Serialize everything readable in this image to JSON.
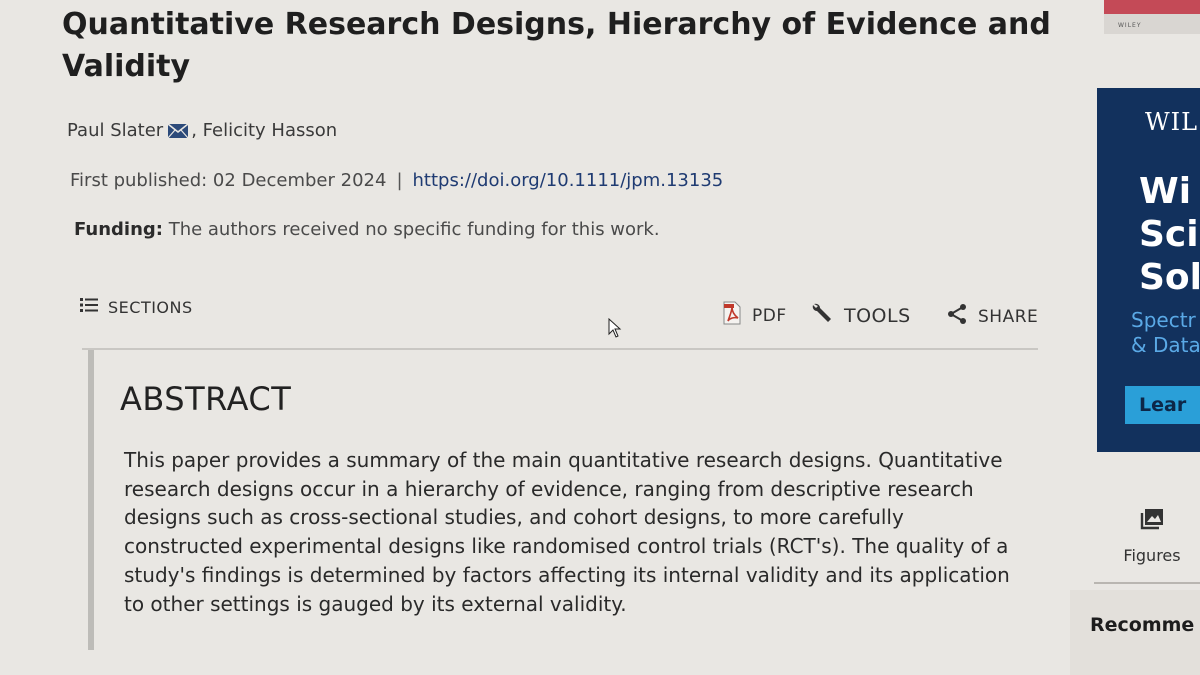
{
  "article": {
    "title": "Quantitative Research Designs, Hierarchy of Evidence and Validity",
    "authors": [
      "Paul Slater",
      ", Felicity Hasson"
    ],
    "first_published_label": "First published: 02 December 2024",
    "separator": "|",
    "doi": "https://doi.org/10.1111/jpm.13135",
    "funding_label": "Funding:",
    "funding_text": " The authors received no specific funding for this work."
  },
  "toolbar": {
    "sections": "SECTIONS",
    "pdf": "PDF",
    "tools": "TOOLS",
    "share": "SHARE"
  },
  "abstract": {
    "heading": "ABSTRACT",
    "lines": [
      "This paper provides a summary of the main quantitative research designs. Quantitative",
      "research designs occur in a hierarchy of evidence, ranging from descriptive research",
      "designs such as cross-sectional studies, and cohort designs, to more carefully",
      "constructed experimental designs like randomised control trials (RCT's). The quality of a",
      "study's findings is determined by factors affecting its internal validity and its application",
      "to other settings is gauged by its external validity."
    ]
  },
  "sidebar": {
    "ad_top_tag": "WILEY",
    "ad_brand": "WIL",
    "ad_headline": [
      "Wi",
      "Sci",
      "Sol"
    ],
    "ad_sub": [
      "Spectr",
      "& Data"
    ],
    "ad_button": "Lear",
    "figures_label": "Figures",
    "recommended_label": "Recomme"
  },
  "icons": {
    "mail": "envelope-icon",
    "sections": "list-icon",
    "pdf": "pdf-icon",
    "tools": "wrench-icon",
    "share": "share-icon",
    "figures": "image-icon"
  },
  "colors": {
    "background": "#e9e7e3",
    "doi_link": "#1f3b72",
    "ad_background": "#12315d",
    "ad_accent": "#5aa9e6",
    "ad_button": "#2a9fd8",
    "pdf_red": "#c0392b"
  }
}
